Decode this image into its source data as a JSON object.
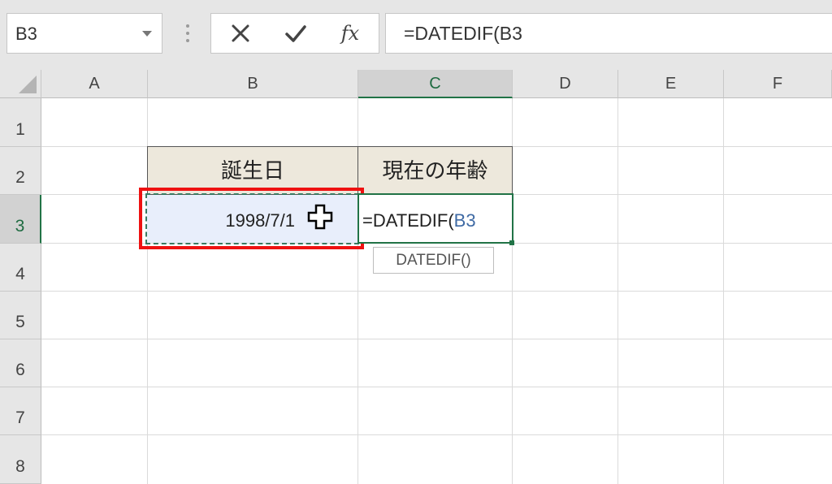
{
  "formula_bar": {
    "name_box": "B3",
    "cancel_icon": "x-icon",
    "enter_icon": "check-icon",
    "function_label": "fx",
    "formula": "=DATEDIF(B3"
  },
  "columns": [
    "A",
    "B",
    "C",
    "D",
    "E",
    "F"
  ],
  "rows": [
    "1",
    "2",
    "3",
    "4",
    "5",
    "6",
    "7",
    "8"
  ],
  "cells": {
    "B2": "誕生日",
    "C2": "現在の年齢",
    "B3": "1998/7/1",
    "C3_prefix": "=DATEDIF(",
    "C3_ref": "B3"
  },
  "tooltip": "DATEDIF()",
  "colors": {
    "selection_green": "#217346",
    "highlight_red": "#ee1111",
    "header_fill": "#ede8dc",
    "selected_cell_fill": "#e8eefb",
    "reference_blue": "#3f6aa4"
  }
}
